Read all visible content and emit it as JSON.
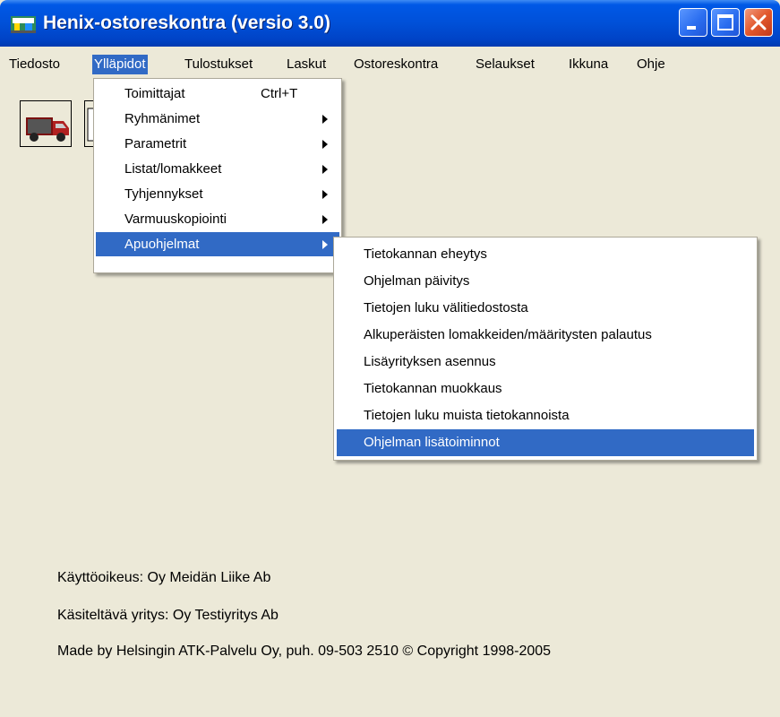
{
  "window": {
    "title": "Henix-ostoreskontra (versio 3.0)"
  },
  "menubar": {
    "items": [
      {
        "label": "Tiedosto"
      },
      {
        "label": "Ylläpidot"
      },
      {
        "label": "Tulostukset"
      },
      {
        "label": "Laskut"
      },
      {
        "label": "Ostoreskontra"
      },
      {
        "label": "Selaukset"
      },
      {
        "label": "Ikkuna"
      },
      {
        "label": "Ohje"
      }
    ],
    "active": "Ylläpidot"
  },
  "dropdown": {
    "items": [
      {
        "label": "Toimittajat",
        "shortcut": "Ctrl+T"
      },
      {
        "label": "Ryhmänimet"
      },
      {
        "label": "Parametrit"
      },
      {
        "label": "Listat/lomakkeet"
      },
      {
        "label": "Tyhjennykset"
      },
      {
        "label": "Varmuuskopiointi"
      },
      {
        "label": "Apuohjelmat"
      }
    ],
    "highlighted": "Apuohjelmat"
  },
  "submenu": {
    "items": [
      {
        "label": "Tietokannan eheytys"
      },
      {
        "label": "Ohjelman päivitys"
      },
      {
        "label": "Tietojen luku välitiedostosta"
      },
      {
        "label": "Alkuperäisten lomakkeiden/määritysten palautus"
      },
      {
        "label": "Lisäyrityksen asennus"
      },
      {
        "label": "Tietokannan muokkaus"
      },
      {
        "label": "Tietojen luku muista tietokannoista"
      },
      {
        "label": "Ohjelman lisätoiminnot"
      }
    ],
    "highlighted": "Ohjelman lisätoiminnot"
  },
  "info": {
    "license": "Käyttöoikeus: Oy Meidän Liike Ab",
    "company": "Käsiteltävä yritys: Oy Testiyritys Ab",
    "copyright": "Made by Helsingin ATK-Palvelu Oy, puh. 09-503 2510 © Copyright 1998-2005"
  },
  "colors": {
    "titlebar": "#0054e3",
    "highlight": "#316ac5",
    "background": "#ece9d8",
    "close_button": "#e2582d"
  },
  "icons": {
    "app": "app-icon",
    "toolbar": [
      "truck-icon",
      "document-icon"
    ]
  }
}
